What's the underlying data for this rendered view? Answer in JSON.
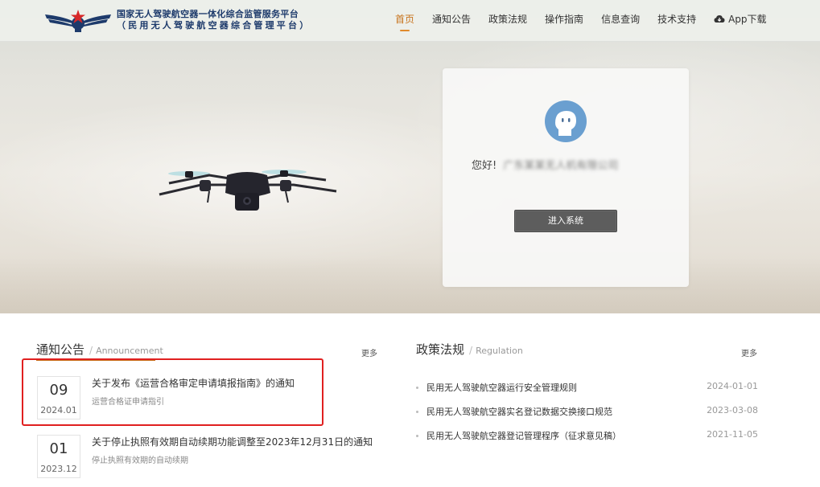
{
  "header": {
    "title_line1": "国家无人驾驶航空器一体化综合监管服务平台",
    "title_line2": "（民用无人驾驶航空器综合管理平台）",
    "nav": [
      {
        "label": "首页",
        "active": true
      },
      {
        "label": "通知公告",
        "active": false
      },
      {
        "label": "政策法规",
        "active": false
      },
      {
        "label": "操作指南",
        "active": false
      },
      {
        "label": "信息查询",
        "active": false
      },
      {
        "label": "技术支持",
        "active": false
      },
      {
        "label": "App下载",
        "active": false,
        "icon": "cloud-download-icon"
      }
    ]
  },
  "card": {
    "greeting_prefix": "您好!",
    "username": "广东某某无人机有限公司",
    "enter_button": "进入系统"
  },
  "notices": {
    "title": "通知公告",
    "subtitle": "Announcement",
    "more": "更多",
    "items": [
      {
        "day": "09",
        "year_month": "2024.01",
        "title": "关于发布《运营合格审定申请填报指南》的通知",
        "summary": "运营合格证申请指引"
      },
      {
        "day": "01",
        "year_month": "2023.12",
        "title": "关于停止执照有效期自动续期功能调整至2023年12月31日的通知",
        "summary": "停止执照有效期的自动续期"
      }
    ]
  },
  "regulations": {
    "title": "政策法规",
    "subtitle": "Regulation",
    "more": "更多",
    "items": [
      {
        "title": "民用无人驾驶航空器运行安全管理规则",
        "date": "2024-01-01"
      },
      {
        "title": "民用无人驾驶航空器实名登记数据交换接口规范",
        "date": "2023-03-08"
      },
      {
        "title": "民用无人驾驶航空器登记管理程序（征求意见稿）",
        "date": "2021-11-05"
      }
    ]
  },
  "colors": {
    "accent": "#c8741e",
    "highlight_border": "#e02020",
    "button_bg": "#5d5d5d",
    "brand_navy": "#1d3a6b"
  }
}
